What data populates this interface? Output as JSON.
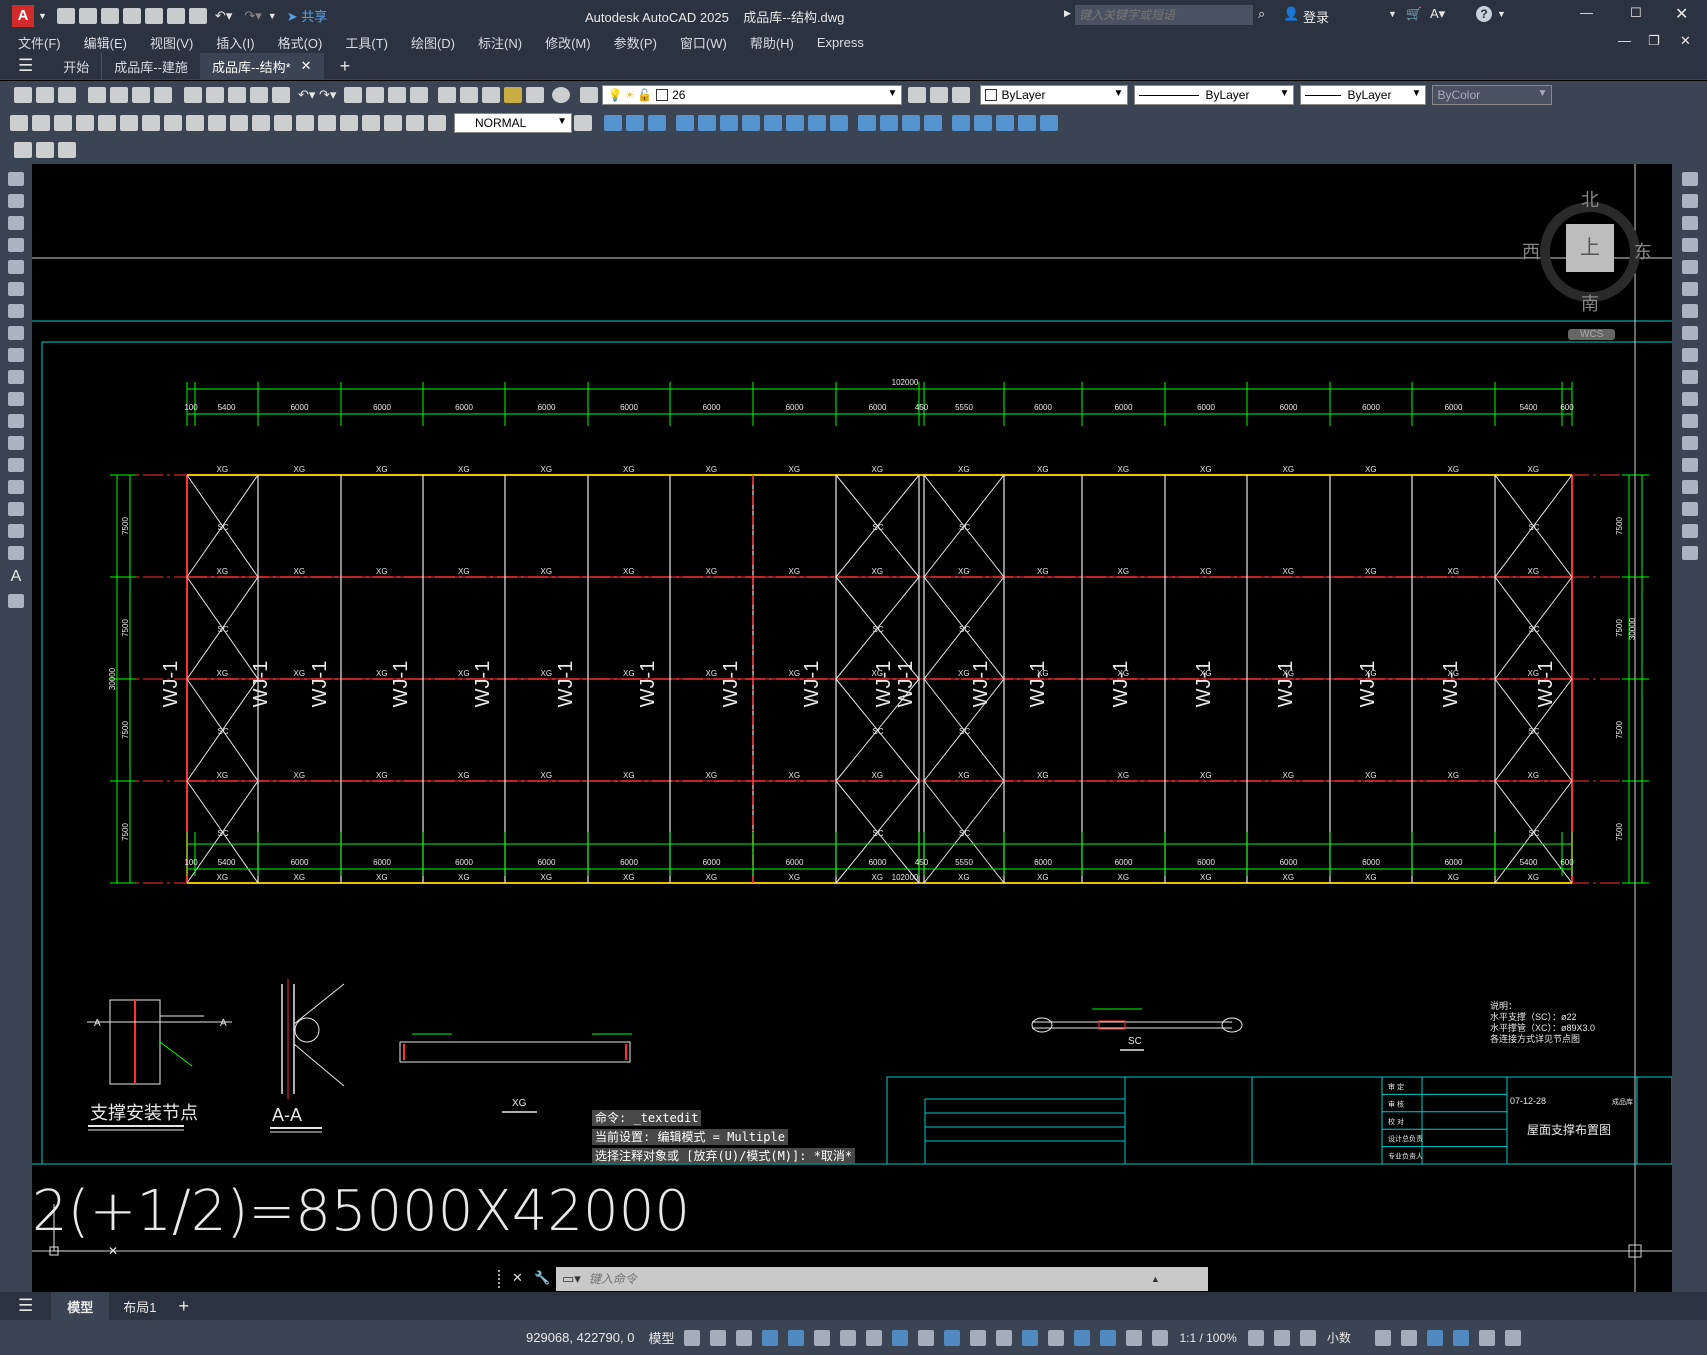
{
  "app": {
    "title": "Autodesk AutoCAD 2025",
    "filename": "成品库--结构.dwg",
    "search_placeholder": "键入关键字或短语",
    "login_label": "登录",
    "share_label": "共享"
  },
  "menu": [
    "文件(F)",
    "编辑(E)",
    "视图(V)",
    "插入(I)",
    "格式(O)",
    "工具(T)",
    "绘图(D)",
    "标注(N)",
    "修改(M)",
    "参数(P)",
    "窗口(W)",
    "帮助(H)",
    "Express"
  ],
  "tabs": {
    "start": "开始",
    "tab1": "成品库--建施",
    "tab2": "成品库--结构*"
  },
  "toolbar": {
    "layer_value": "26",
    "color_value": "ByLayer",
    "linetype_value": "ByLayer",
    "lineweight_value": "ByLayer",
    "plotstyle_value": "ByColor",
    "textstyle_value": "NORMAL"
  },
  "viewcube": {
    "north": "北",
    "south": "南",
    "east": "东",
    "west": "西",
    "top": "上",
    "wcs": "WCS"
  },
  "drawing": {
    "overall_dim": "102000",
    "top_dims": [
      "100",
      "5400",
      "6000",
      "6000",
      "6000",
      "6000",
      "6000",
      "6000",
      "6000",
      "6000",
      "450",
      "5550",
      "6000",
      "6000",
      "6000",
      "6000",
      "6000",
      "6000",
      "5400",
      "600"
    ],
    "bottom_dims": [
      "100",
      "5400",
      "6000",
      "6000",
      "6000",
      "6000",
      "6000",
      "6000",
      "6000",
      "6000",
      "450",
      "5550",
      "6000",
      "6000",
      "6000",
      "6000",
      "6000",
      "6000",
      "5400",
      "600"
    ],
    "side_dims": [
      "7500",
      "7500",
      "7500",
      "7500"
    ],
    "side_total": "30000",
    "xg": "XG",
    "sc": "SC",
    "wj": "WJ-1",
    "detail_title": "支撑安装节点",
    "section_title": "A-A",
    "section_mark": "A",
    "xg_title": "XG",
    "sc_title": "SC",
    "notes": [
      "说明：",
      "水平支撑（SC）：ø22",
      "水平撑管（XC）：ø89X3.0",
      "各连接方式详见节点图"
    ],
    "title_block": {
      "drawing_name": "屋面支撑布置图",
      "date": "07-12-28",
      "project": "成品库",
      "sign_labels": [
        "审 定",
        "审 核",
        "校 对",
        "设计总负责",
        "专业负责人"
      ]
    },
    "big_text": "2(+1/2)=85000X42000"
  },
  "command": {
    "history": [
      "命令: _textedit",
      "当前设置: 编辑模式 = Multiple",
      "选择注释对象或 [放弃(U)/模式(M)]: *取消*"
    ],
    "placeholder": "键入命令"
  },
  "layout_tabs": {
    "model": "模型",
    "layout1": "布局1"
  },
  "status": {
    "coords": "929068, 422790, 0",
    "model": "模型",
    "scale": "1:1 / 100%",
    "units": "小数"
  },
  "colors": {
    "accent": "#5aa0e6",
    "bg": "#3b4453",
    "canvas": "#000000",
    "dim_green": "#00ff00",
    "axis_red": "#ff3030",
    "beam_yellow": "#e8c000"
  }
}
